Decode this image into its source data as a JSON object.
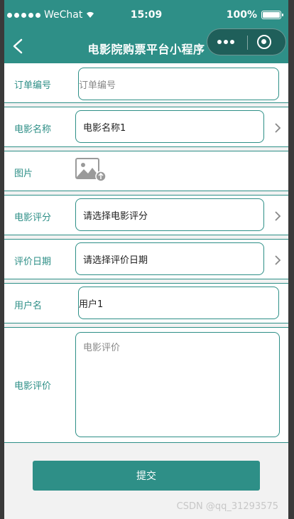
{
  "status_bar": {
    "carrier": "WeChat",
    "time": "15:09",
    "battery": "100%"
  },
  "nav": {
    "title": "电影院购票平台小程序"
  },
  "form": {
    "order_no": {
      "label": "订单编号",
      "placeholder": "订单编号"
    },
    "movie_name": {
      "label": "电影名称",
      "value": "电影名称1"
    },
    "image": {
      "label": "图片"
    },
    "rating": {
      "label": "电影评分",
      "value": "请选择电影评分"
    },
    "review_date": {
      "label": "评价日期",
      "value": "请选择评价日期"
    },
    "username": {
      "label": "用户名",
      "value": "用户1"
    },
    "review": {
      "label": "电影评价",
      "placeholder": "电影评价"
    }
  },
  "submit_label": "提交",
  "watermark": "CSDN @qq_31293575",
  "colors": {
    "accent": "#2e8f87",
    "capsule": "#1f5f5a"
  },
  "icons": [
    "back-icon",
    "more-icon",
    "close-capsule-icon",
    "chevron-right-icon",
    "image-upload-icon"
  ]
}
